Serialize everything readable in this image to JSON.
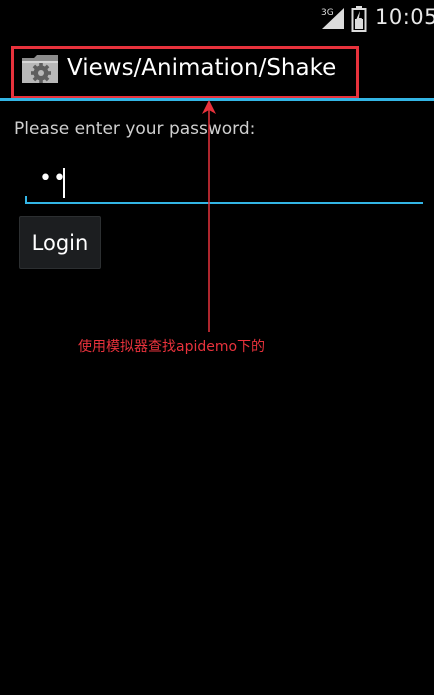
{
  "status_bar": {
    "network_label": "3G",
    "time": "10:05",
    "icons": [
      "signal-icon",
      "battery-icon"
    ]
  },
  "action_bar": {
    "icon": "settings-folder-icon",
    "title": "Views/Animation/Shake"
  },
  "form": {
    "prompt": "Please enter your password:",
    "password_value": "••",
    "login_label": "Login"
  },
  "annotation": {
    "text": "使用模拟器查找apidemo下的"
  },
  "colors": {
    "background": "#000000",
    "accent": "#33b5e5",
    "annotation_red": "#e8323c",
    "button_bg": "#1c1e20"
  }
}
